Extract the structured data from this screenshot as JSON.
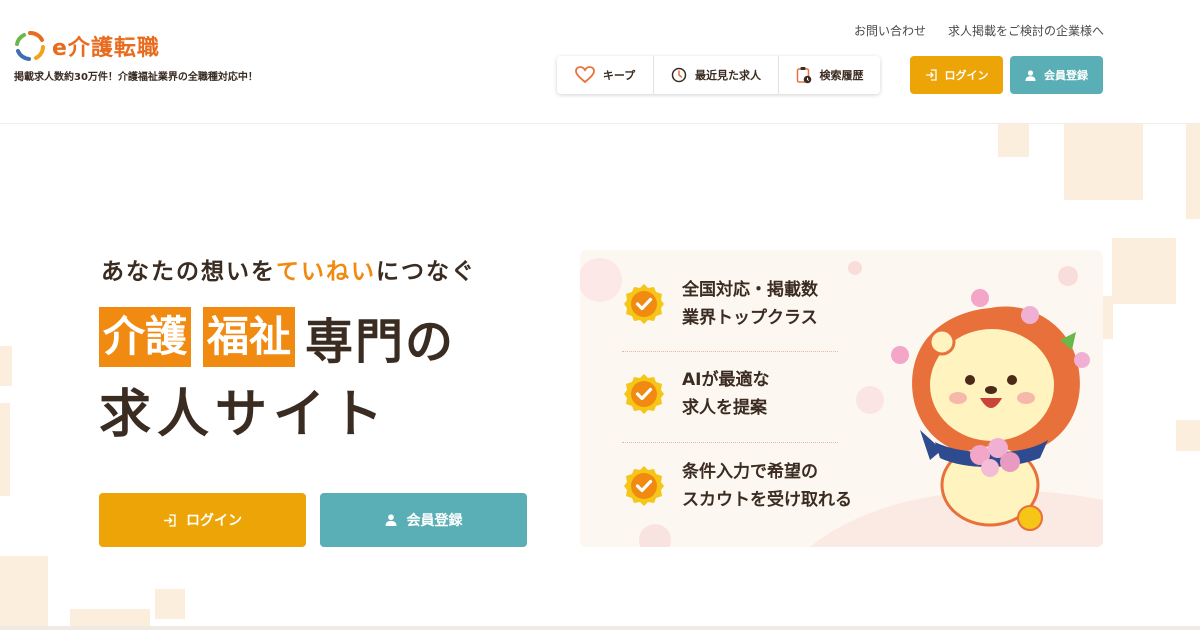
{
  "header": {
    "logo_text": "e介護転職",
    "tagline": "掲載求人数約30万件！介護福祉業界の全職種対応中！",
    "contact_link": "お問い合わせ",
    "business_link": "求人掲載をご検討の企業様へ",
    "quicknav": {
      "keep": "キープ",
      "recent": "最近見た求人",
      "history": "検索履歴"
    },
    "login_label": "ログイン",
    "register_label": "会員登録"
  },
  "hero": {
    "catch_pre": "あなたの想いを",
    "catch_highlight": "ていねい",
    "catch_post": "につなぐ",
    "title_box_1": "介護",
    "title_box_2": "福祉",
    "title_rest": "専門の",
    "title_line_2": "求人サイト",
    "login_label": "ログイン",
    "register_label": "会員登録"
  },
  "features": [
    {
      "line1": "全国対応・掲載数",
      "line2": "業界トップクラス"
    },
    {
      "line1": "AIが最適な",
      "line2": "求人を提案"
    },
    {
      "line1": "条件入力で希望の",
      "line2": "スカウトを受け取れる"
    }
  ],
  "colors": {
    "brand_orange": "#f08a10",
    "login_yellow": "#eda407",
    "register_teal": "#5aafb6",
    "text_dark": "#3b2c22"
  },
  "icons": {
    "keep": "heart-icon",
    "recent": "clock-icon",
    "history": "clipboard-clock-icon",
    "login": "login-arrow-icon",
    "register": "person-icon",
    "feature": "check-badge-icon"
  }
}
